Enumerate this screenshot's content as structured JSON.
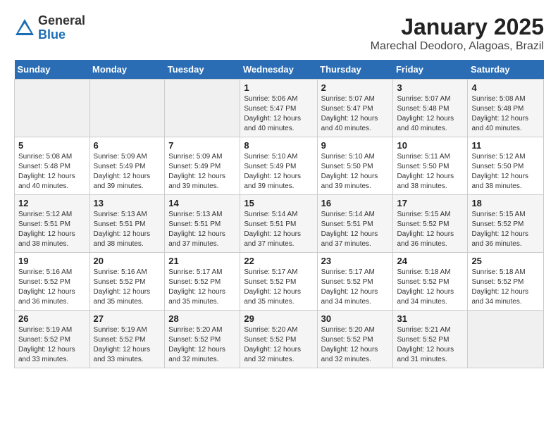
{
  "logo": {
    "general": "General",
    "blue": "Blue"
  },
  "title": "January 2025",
  "subtitle": "Marechal Deodoro, Alagoas, Brazil",
  "days_of_week": [
    "Sunday",
    "Monday",
    "Tuesday",
    "Wednesday",
    "Thursday",
    "Friday",
    "Saturday"
  ],
  "weeks": [
    [
      {
        "day": "",
        "info": ""
      },
      {
        "day": "",
        "info": ""
      },
      {
        "day": "",
        "info": ""
      },
      {
        "day": "1",
        "info": "Sunrise: 5:06 AM\nSunset: 5:47 PM\nDaylight: 12 hours\nand 40 minutes."
      },
      {
        "day": "2",
        "info": "Sunrise: 5:07 AM\nSunset: 5:47 PM\nDaylight: 12 hours\nand 40 minutes."
      },
      {
        "day": "3",
        "info": "Sunrise: 5:07 AM\nSunset: 5:48 PM\nDaylight: 12 hours\nand 40 minutes."
      },
      {
        "day": "4",
        "info": "Sunrise: 5:08 AM\nSunset: 5:48 PM\nDaylight: 12 hours\nand 40 minutes."
      }
    ],
    [
      {
        "day": "5",
        "info": "Sunrise: 5:08 AM\nSunset: 5:48 PM\nDaylight: 12 hours\nand 40 minutes."
      },
      {
        "day": "6",
        "info": "Sunrise: 5:09 AM\nSunset: 5:49 PM\nDaylight: 12 hours\nand 39 minutes."
      },
      {
        "day": "7",
        "info": "Sunrise: 5:09 AM\nSunset: 5:49 PM\nDaylight: 12 hours\nand 39 minutes."
      },
      {
        "day": "8",
        "info": "Sunrise: 5:10 AM\nSunset: 5:49 PM\nDaylight: 12 hours\nand 39 minutes."
      },
      {
        "day": "9",
        "info": "Sunrise: 5:10 AM\nSunset: 5:50 PM\nDaylight: 12 hours\nand 39 minutes."
      },
      {
        "day": "10",
        "info": "Sunrise: 5:11 AM\nSunset: 5:50 PM\nDaylight: 12 hours\nand 38 minutes."
      },
      {
        "day": "11",
        "info": "Sunrise: 5:12 AM\nSunset: 5:50 PM\nDaylight: 12 hours\nand 38 minutes."
      }
    ],
    [
      {
        "day": "12",
        "info": "Sunrise: 5:12 AM\nSunset: 5:51 PM\nDaylight: 12 hours\nand 38 minutes."
      },
      {
        "day": "13",
        "info": "Sunrise: 5:13 AM\nSunset: 5:51 PM\nDaylight: 12 hours\nand 38 minutes."
      },
      {
        "day": "14",
        "info": "Sunrise: 5:13 AM\nSunset: 5:51 PM\nDaylight: 12 hours\nand 37 minutes."
      },
      {
        "day": "15",
        "info": "Sunrise: 5:14 AM\nSunset: 5:51 PM\nDaylight: 12 hours\nand 37 minutes."
      },
      {
        "day": "16",
        "info": "Sunrise: 5:14 AM\nSunset: 5:51 PM\nDaylight: 12 hours\nand 37 minutes."
      },
      {
        "day": "17",
        "info": "Sunrise: 5:15 AM\nSunset: 5:52 PM\nDaylight: 12 hours\nand 36 minutes."
      },
      {
        "day": "18",
        "info": "Sunrise: 5:15 AM\nSunset: 5:52 PM\nDaylight: 12 hours\nand 36 minutes."
      }
    ],
    [
      {
        "day": "19",
        "info": "Sunrise: 5:16 AM\nSunset: 5:52 PM\nDaylight: 12 hours\nand 36 minutes."
      },
      {
        "day": "20",
        "info": "Sunrise: 5:16 AM\nSunset: 5:52 PM\nDaylight: 12 hours\nand 35 minutes."
      },
      {
        "day": "21",
        "info": "Sunrise: 5:17 AM\nSunset: 5:52 PM\nDaylight: 12 hours\nand 35 minutes."
      },
      {
        "day": "22",
        "info": "Sunrise: 5:17 AM\nSunset: 5:52 PM\nDaylight: 12 hours\nand 35 minutes."
      },
      {
        "day": "23",
        "info": "Sunrise: 5:17 AM\nSunset: 5:52 PM\nDaylight: 12 hours\nand 34 minutes."
      },
      {
        "day": "24",
        "info": "Sunrise: 5:18 AM\nSunset: 5:52 PM\nDaylight: 12 hours\nand 34 minutes."
      },
      {
        "day": "25",
        "info": "Sunrise: 5:18 AM\nSunset: 5:52 PM\nDaylight: 12 hours\nand 34 minutes."
      }
    ],
    [
      {
        "day": "26",
        "info": "Sunrise: 5:19 AM\nSunset: 5:52 PM\nDaylight: 12 hours\nand 33 minutes."
      },
      {
        "day": "27",
        "info": "Sunrise: 5:19 AM\nSunset: 5:52 PM\nDaylight: 12 hours\nand 33 minutes."
      },
      {
        "day": "28",
        "info": "Sunrise: 5:20 AM\nSunset: 5:52 PM\nDaylight: 12 hours\nand 32 minutes."
      },
      {
        "day": "29",
        "info": "Sunrise: 5:20 AM\nSunset: 5:52 PM\nDaylight: 12 hours\nand 32 minutes."
      },
      {
        "day": "30",
        "info": "Sunrise: 5:20 AM\nSunset: 5:52 PM\nDaylight: 12 hours\nand 32 minutes."
      },
      {
        "day": "31",
        "info": "Sunrise: 5:21 AM\nSunset: 5:52 PM\nDaylight: 12 hours\nand 31 minutes."
      },
      {
        "day": "",
        "info": ""
      }
    ]
  ]
}
